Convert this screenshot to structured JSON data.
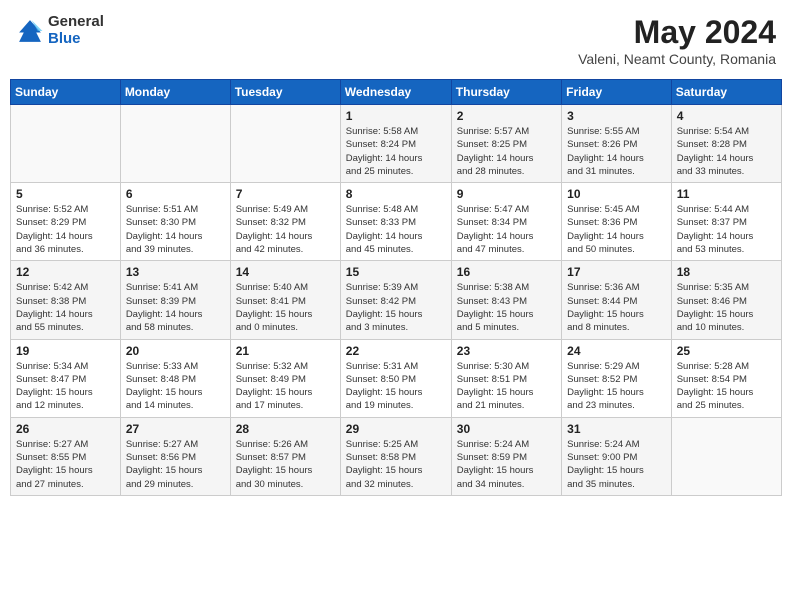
{
  "header": {
    "logo_general": "General",
    "logo_blue": "Blue",
    "month_title": "May 2024",
    "subtitle": "Valeni, Neamt County, Romania"
  },
  "days_of_week": [
    "Sunday",
    "Monday",
    "Tuesday",
    "Wednesday",
    "Thursday",
    "Friday",
    "Saturday"
  ],
  "weeks": [
    [
      {
        "day": "",
        "info": ""
      },
      {
        "day": "",
        "info": ""
      },
      {
        "day": "",
        "info": ""
      },
      {
        "day": "1",
        "info": "Sunrise: 5:58 AM\nSunset: 8:24 PM\nDaylight: 14 hours\nand 25 minutes."
      },
      {
        "day": "2",
        "info": "Sunrise: 5:57 AM\nSunset: 8:25 PM\nDaylight: 14 hours\nand 28 minutes."
      },
      {
        "day": "3",
        "info": "Sunrise: 5:55 AM\nSunset: 8:26 PM\nDaylight: 14 hours\nand 31 minutes."
      },
      {
        "day": "4",
        "info": "Sunrise: 5:54 AM\nSunset: 8:28 PM\nDaylight: 14 hours\nand 33 minutes."
      }
    ],
    [
      {
        "day": "5",
        "info": "Sunrise: 5:52 AM\nSunset: 8:29 PM\nDaylight: 14 hours\nand 36 minutes."
      },
      {
        "day": "6",
        "info": "Sunrise: 5:51 AM\nSunset: 8:30 PM\nDaylight: 14 hours\nand 39 minutes."
      },
      {
        "day": "7",
        "info": "Sunrise: 5:49 AM\nSunset: 8:32 PM\nDaylight: 14 hours\nand 42 minutes."
      },
      {
        "day": "8",
        "info": "Sunrise: 5:48 AM\nSunset: 8:33 PM\nDaylight: 14 hours\nand 45 minutes."
      },
      {
        "day": "9",
        "info": "Sunrise: 5:47 AM\nSunset: 8:34 PM\nDaylight: 14 hours\nand 47 minutes."
      },
      {
        "day": "10",
        "info": "Sunrise: 5:45 AM\nSunset: 8:36 PM\nDaylight: 14 hours\nand 50 minutes."
      },
      {
        "day": "11",
        "info": "Sunrise: 5:44 AM\nSunset: 8:37 PM\nDaylight: 14 hours\nand 53 minutes."
      }
    ],
    [
      {
        "day": "12",
        "info": "Sunrise: 5:42 AM\nSunset: 8:38 PM\nDaylight: 14 hours\nand 55 minutes."
      },
      {
        "day": "13",
        "info": "Sunrise: 5:41 AM\nSunset: 8:39 PM\nDaylight: 14 hours\nand 58 minutes."
      },
      {
        "day": "14",
        "info": "Sunrise: 5:40 AM\nSunset: 8:41 PM\nDaylight: 15 hours\nand 0 minutes."
      },
      {
        "day": "15",
        "info": "Sunrise: 5:39 AM\nSunset: 8:42 PM\nDaylight: 15 hours\nand 3 minutes."
      },
      {
        "day": "16",
        "info": "Sunrise: 5:38 AM\nSunset: 8:43 PM\nDaylight: 15 hours\nand 5 minutes."
      },
      {
        "day": "17",
        "info": "Sunrise: 5:36 AM\nSunset: 8:44 PM\nDaylight: 15 hours\nand 8 minutes."
      },
      {
        "day": "18",
        "info": "Sunrise: 5:35 AM\nSunset: 8:46 PM\nDaylight: 15 hours\nand 10 minutes."
      }
    ],
    [
      {
        "day": "19",
        "info": "Sunrise: 5:34 AM\nSunset: 8:47 PM\nDaylight: 15 hours\nand 12 minutes."
      },
      {
        "day": "20",
        "info": "Sunrise: 5:33 AM\nSunset: 8:48 PM\nDaylight: 15 hours\nand 14 minutes."
      },
      {
        "day": "21",
        "info": "Sunrise: 5:32 AM\nSunset: 8:49 PM\nDaylight: 15 hours\nand 17 minutes."
      },
      {
        "day": "22",
        "info": "Sunrise: 5:31 AM\nSunset: 8:50 PM\nDaylight: 15 hours\nand 19 minutes."
      },
      {
        "day": "23",
        "info": "Sunrise: 5:30 AM\nSunset: 8:51 PM\nDaylight: 15 hours\nand 21 minutes."
      },
      {
        "day": "24",
        "info": "Sunrise: 5:29 AM\nSunset: 8:52 PM\nDaylight: 15 hours\nand 23 minutes."
      },
      {
        "day": "25",
        "info": "Sunrise: 5:28 AM\nSunset: 8:54 PM\nDaylight: 15 hours\nand 25 minutes."
      }
    ],
    [
      {
        "day": "26",
        "info": "Sunrise: 5:27 AM\nSunset: 8:55 PM\nDaylight: 15 hours\nand 27 minutes."
      },
      {
        "day": "27",
        "info": "Sunrise: 5:27 AM\nSunset: 8:56 PM\nDaylight: 15 hours\nand 29 minutes."
      },
      {
        "day": "28",
        "info": "Sunrise: 5:26 AM\nSunset: 8:57 PM\nDaylight: 15 hours\nand 30 minutes."
      },
      {
        "day": "29",
        "info": "Sunrise: 5:25 AM\nSunset: 8:58 PM\nDaylight: 15 hours\nand 32 minutes."
      },
      {
        "day": "30",
        "info": "Sunrise: 5:24 AM\nSunset: 8:59 PM\nDaylight: 15 hours\nand 34 minutes."
      },
      {
        "day": "31",
        "info": "Sunrise: 5:24 AM\nSunset: 9:00 PM\nDaylight: 15 hours\nand 35 minutes."
      },
      {
        "day": "",
        "info": ""
      }
    ]
  ]
}
